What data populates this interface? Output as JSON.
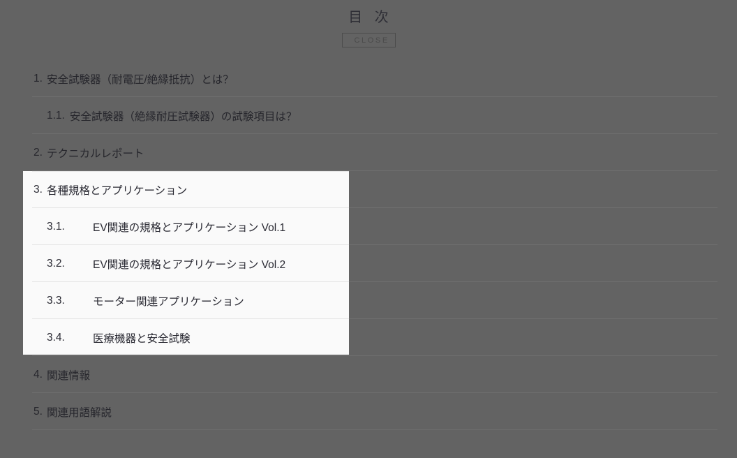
{
  "header": {
    "title": "目 次",
    "close_label": "CLOSE"
  },
  "colors": {
    "page_background": "#636363",
    "panel_background": "#fafafa",
    "text": "#26262c",
    "divider_dim": "#6e6e6e",
    "divider_light": "#e6e6e6"
  },
  "toc": {
    "items": [
      {
        "level": 1,
        "number": "1.",
        "text": "安全試験器（耐電圧/絶縁抵抗）とは？"
      },
      {
        "level": 2,
        "number": "1.1.",
        "text": "安全試験器（絶縁耐圧試験器）の試験項目は？"
      },
      {
        "level": 1,
        "number": "2.",
        "text": "テクニカルレポート"
      },
      {
        "level": 1,
        "number": "3.",
        "text": "各種規格とアプリケーション"
      },
      {
        "level": 2,
        "number": "3.1.",
        "text": "EV関連の規格とアプリケーション Vol.1"
      },
      {
        "level": 2,
        "number": "3.2.",
        "text": "EV関連の規格とアプリケーション Vol.2"
      },
      {
        "level": 2,
        "number": "3.3.",
        "text": "モーター関連アプリケーション"
      },
      {
        "level": 2,
        "number": "3.4.",
        "text": "医療機器と安全試験"
      },
      {
        "level": 1,
        "number": "4.",
        "text": "関連情報"
      },
      {
        "level": 1,
        "number": "5.",
        "text": "関連用語解説"
      }
    ],
    "highlighted_items": [
      {
        "level": 1,
        "number": "3.",
        "text": "各種規格とアプリケーション"
      },
      {
        "level": 2,
        "number": "3.1.",
        "text": "EV関連の規格とアプリケーション Vol.1"
      },
      {
        "level": 2,
        "number": "3.2.",
        "text": "EV関連の規格とアプリケーション Vol.2"
      },
      {
        "level": 2,
        "number": "3.3.",
        "text": "モーター関連アプリケーション"
      },
      {
        "level": 2,
        "number": "3.4.",
        "text": "医療機器と安全試験"
      }
    ]
  }
}
